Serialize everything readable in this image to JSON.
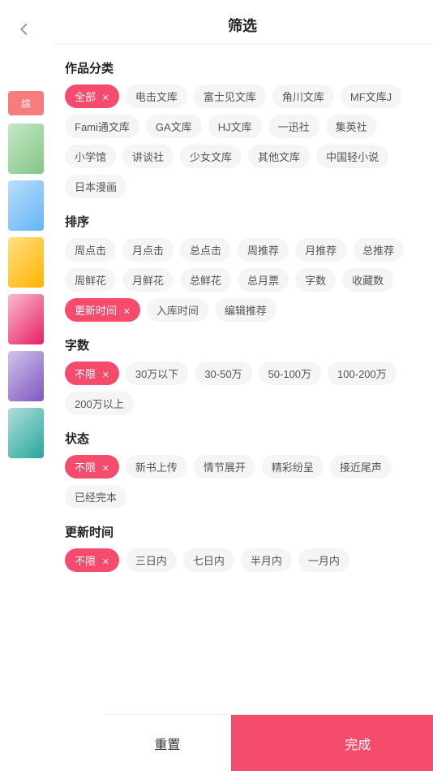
{
  "header": {
    "title": "筛选",
    "back_label": "返回"
  },
  "sections": {
    "category": {
      "title": "作品分类",
      "tags": [
        {
          "label": "全部",
          "active": true,
          "closable": true
        },
        {
          "label": "电击文库",
          "active": false
        },
        {
          "label": "富士见文库",
          "active": false
        },
        {
          "label": "角川文库",
          "active": false
        },
        {
          "label": "MF文库J",
          "active": false
        },
        {
          "label": "Fami通文库",
          "active": false
        },
        {
          "label": "GA文库",
          "active": false
        },
        {
          "label": "HJ文库",
          "active": false
        },
        {
          "label": "一迅社",
          "active": false
        },
        {
          "label": "集英社",
          "active": false
        },
        {
          "label": "小学馆",
          "active": false
        },
        {
          "label": "讲谈社",
          "active": false
        },
        {
          "label": "少女文库",
          "active": false
        },
        {
          "label": "其他文库",
          "active": false
        },
        {
          "label": "中国轻小说",
          "active": false
        },
        {
          "label": "日本漫画",
          "active": false
        }
      ]
    },
    "sort": {
      "title": "排序",
      "tags": [
        {
          "label": "周点击",
          "active": false
        },
        {
          "label": "月点击",
          "active": false
        },
        {
          "label": "总点击",
          "active": false
        },
        {
          "label": "周推荐",
          "active": false
        },
        {
          "label": "月推荐",
          "active": false
        },
        {
          "label": "总推荐",
          "active": false
        },
        {
          "label": "周鲜花",
          "active": false
        },
        {
          "label": "月鲜花",
          "active": false
        },
        {
          "label": "总鲜花",
          "active": false
        },
        {
          "label": "总月票",
          "active": false
        },
        {
          "label": "字数",
          "active": false
        },
        {
          "label": "收藏数",
          "active": false
        },
        {
          "label": "更新时间",
          "active": true,
          "closable": true
        },
        {
          "label": "入库时间",
          "active": false
        },
        {
          "label": "编辑推荐",
          "active": false
        }
      ]
    },
    "wordcount": {
      "title": "字数",
      "tags": [
        {
          "label": "不限",
          "active": true,
          "closable": true
        },
        {
          "label": "30万以下",
          "active": false
        },
        {
          "label": "30-50万",
          "active": false
        },
        {
          "label": "50-100万",
          "active": false
        },
        {
          "label": "100-200万",
          "active": false
        },
        {
          "label": "200万以上",
          "active": false
        }
      ]
    },
    "status": {
      "title": "状态",
      "tags": [
        {
          "label": "不限",
          "active": true,
          "closable": true
        },
        {
          "label": "新书上传",
          "active": false
        },
        {
          "label": "情节展开",
          "active": false
        },
        {
          "label": "精彩纷呈",
          "active": false
        },
        {
          "label": "接近尾声",
          "active": false
        },
        {
          "label": "已经完本",
          "active": false
        }
      ]
    },
    "updatetime": {
      "title": "更新时间",
      "tags": [
        {
          "label": "不限",
          "active": true,
          "closable": true
        },
        {
          "label": "三日内",
          "active": false
        },
        {
          "label": "七日内",
          "active": false
        },
        {
          "label": "半月内",
          "active": false
        },
        {
          "label": "一月内",
          "active": false
        }
      ]
    }
  },
  "footer": {
    "reset_label": "重置",
    "confirm_label": "完成"
  },
  "side": {
    "tag_label": "综"
  }
}
